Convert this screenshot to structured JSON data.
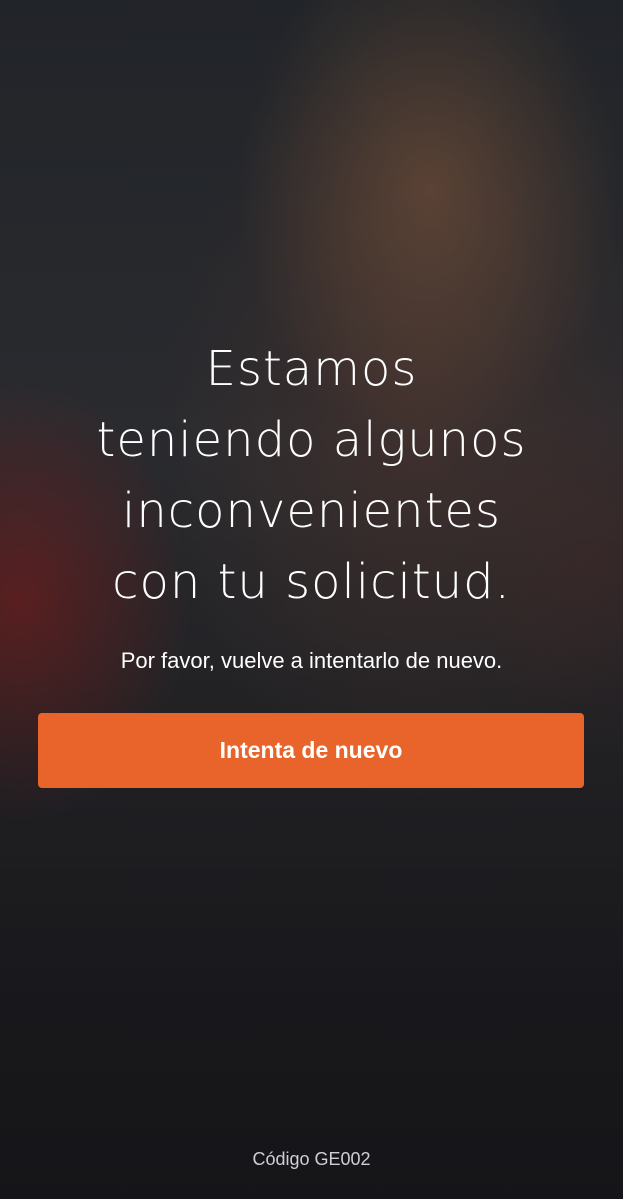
{
  "error_screen": {
    "headline_lines": [
      "Estamos",
      "teniendo algunos",
      "inconvenientes",
      "con tu solicitud."
    ],
    "subtitle": "Por favor, vuelve a intentarlo de nuevo.",
    "retry_button_label": "Intenta de nuevo",
    "error_code": "Código GE002"
  },
  "colors": {
    "accent_button": "#e8642b",
    "text_primary": "#ffffff",
    "text_muted": "#cfcfd2",
    "background_dark": "#1a1b1f"
  }
}
